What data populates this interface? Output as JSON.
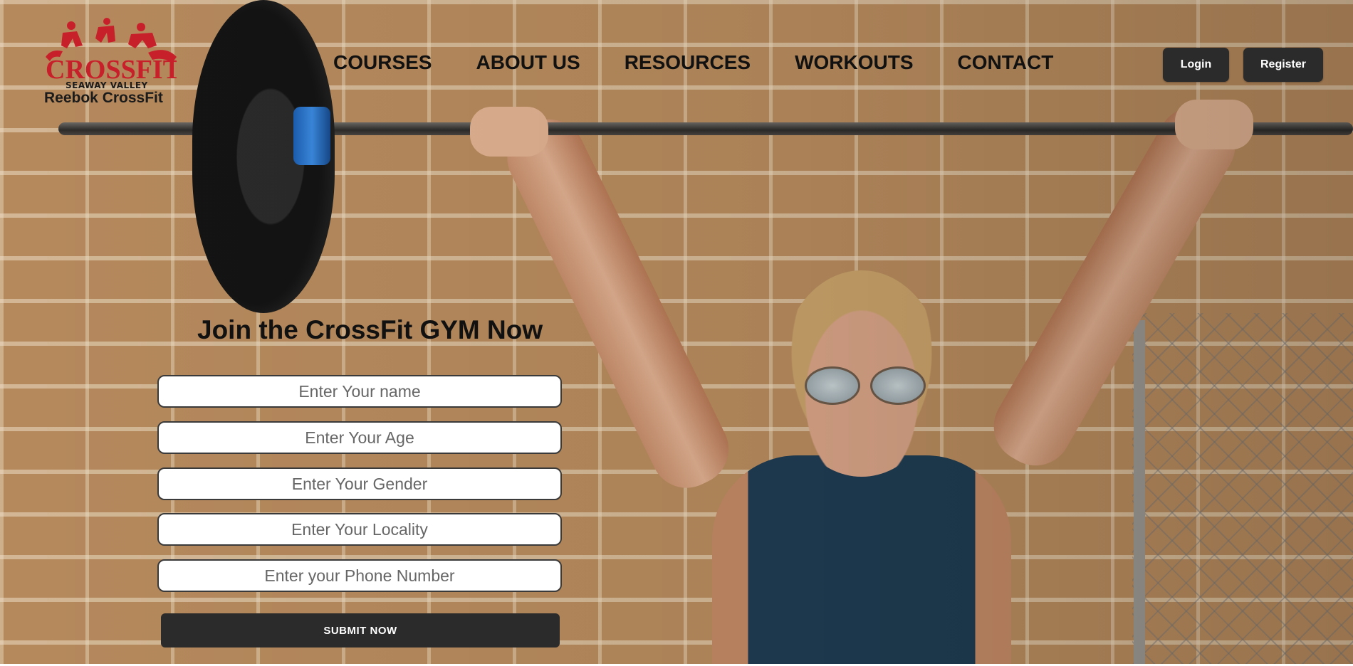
{
  "brand": {
    "logo_text": "CROSSFIT",
    "logo_sub": "SEAWAY VALLEY",
    "name": "Reebok CrossFit"
  },
  "nav": {
    "items": [
      "COURSES",
      "ABOUT US",
      "RESOURCES",
      "WORKOUTS",
      "CONTACT"
    ]
  },
  "auth": {
    "login_label": "Login",
    "register_label": "Register"
  },
  "form": {
    "title": "Join the CrossFit GYM Now",
    "fields": [
      {
        "placeholder": "Enter Your name"
      },
      {
        "placeholder": "Enter Your Age"
      },
      {
        "placeholder": "Enter Your Gender"
      },
      {
        "placeholder": "Enter Your Locality"
      },
      {
        "placeholder": "Enter your Phone Number"
      }
    ],
    "submit_label": "SUBMIT  NOW"
  },
  "colors": {
    "brand_red": "#c8202b",
    "button_dark": "#2b2b2b",
    "text_dark": "#111111"
  }
}
